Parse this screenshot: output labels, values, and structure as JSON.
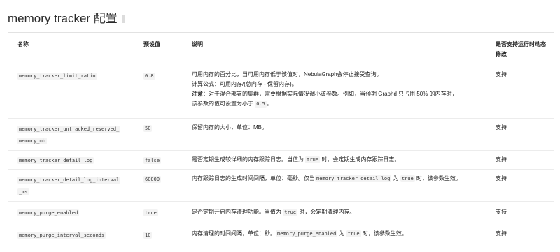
{
  "title": "memory tracker 配置",
  "table": {
    "headers": [
      "名称",
      "预设值",
      "说明",
      "是否支持运行时动态修改"
    ],
    "rows": [
      {
        "name": "memory_tracker_limit_ratio",
        "default": "0.8",
        "desc_line1": "可用内存的百分比，当可用内存低于该值时，NebulaGraph会停止接受查询。",
        "desc_line2": "计算公式：可用内存/(总内存 - 保留内存)。",
        "desc_note_label": "注意",
        "desc_note_text": "：对于混合部署的集群，需要根据实际情况调小该参数。例如，当预期 Graphd 只占用 50% 的内存时，",
        "desc_line4_pre": "该参数的值可设置为小于",
        "desc_line4_code": "0.5",
        "desc_line4_post": "。",
        "dynamic": "支持"
      },
      {
        "name_line1": "memory_tracker_untracked_reserved_",
        "name_line2": "memory_mb",
        "default": "50",
        "desc": "保留内存的大小，单位：MB。",
        "dynamic": "支持"
      },
      {
        "name": "memory_tracker_detail_log",
        "default": "false",
        "desc_pre": "是否定期生成较详细的内存跟踪日志。当值为",
        "desc_code": "true",
        "desc_post": "时，会定期生成内存跟踪日志。",
        "dynamic": "支持"
      },
      {
        "name_line1": "memory_tracker_detail_log_interval",
        "name_line2": "_ms",
        "default": "60000",
        "desc_pre": "内存跟踪日志的生成时间间隔，单位：毫秒。仅当",
        "desc_code1": "memory_tracker_detail_log",
        "desc_mid": "为",
        "desc_code2": "true",
        "desc_post": "时，该参数生效。",
        "dynamic": "支持"
      },
      {
        "name": "memory_purge_enabled",
        "default": "true",
        "desc_pre": "是否定期开启内存清理功能。当值为",
        "desc_code": "true",
        "desc_post": "时，会定期清理内存。",
        "dynamic": "支持"
      },
      {
        "name": "memory_purge_interval_seconds",
        "default": "10",
        "desc_pre": "内存清理的时间间隔，单位：秒。",
        "desc_code1": "memory_purge_enabled",
        "desc_mid": "为",
        "desc_code2": "true",
        "desc_post": "时，该参数生效。",
        "dynamic": "支持"
      }
    ]
  }
}
